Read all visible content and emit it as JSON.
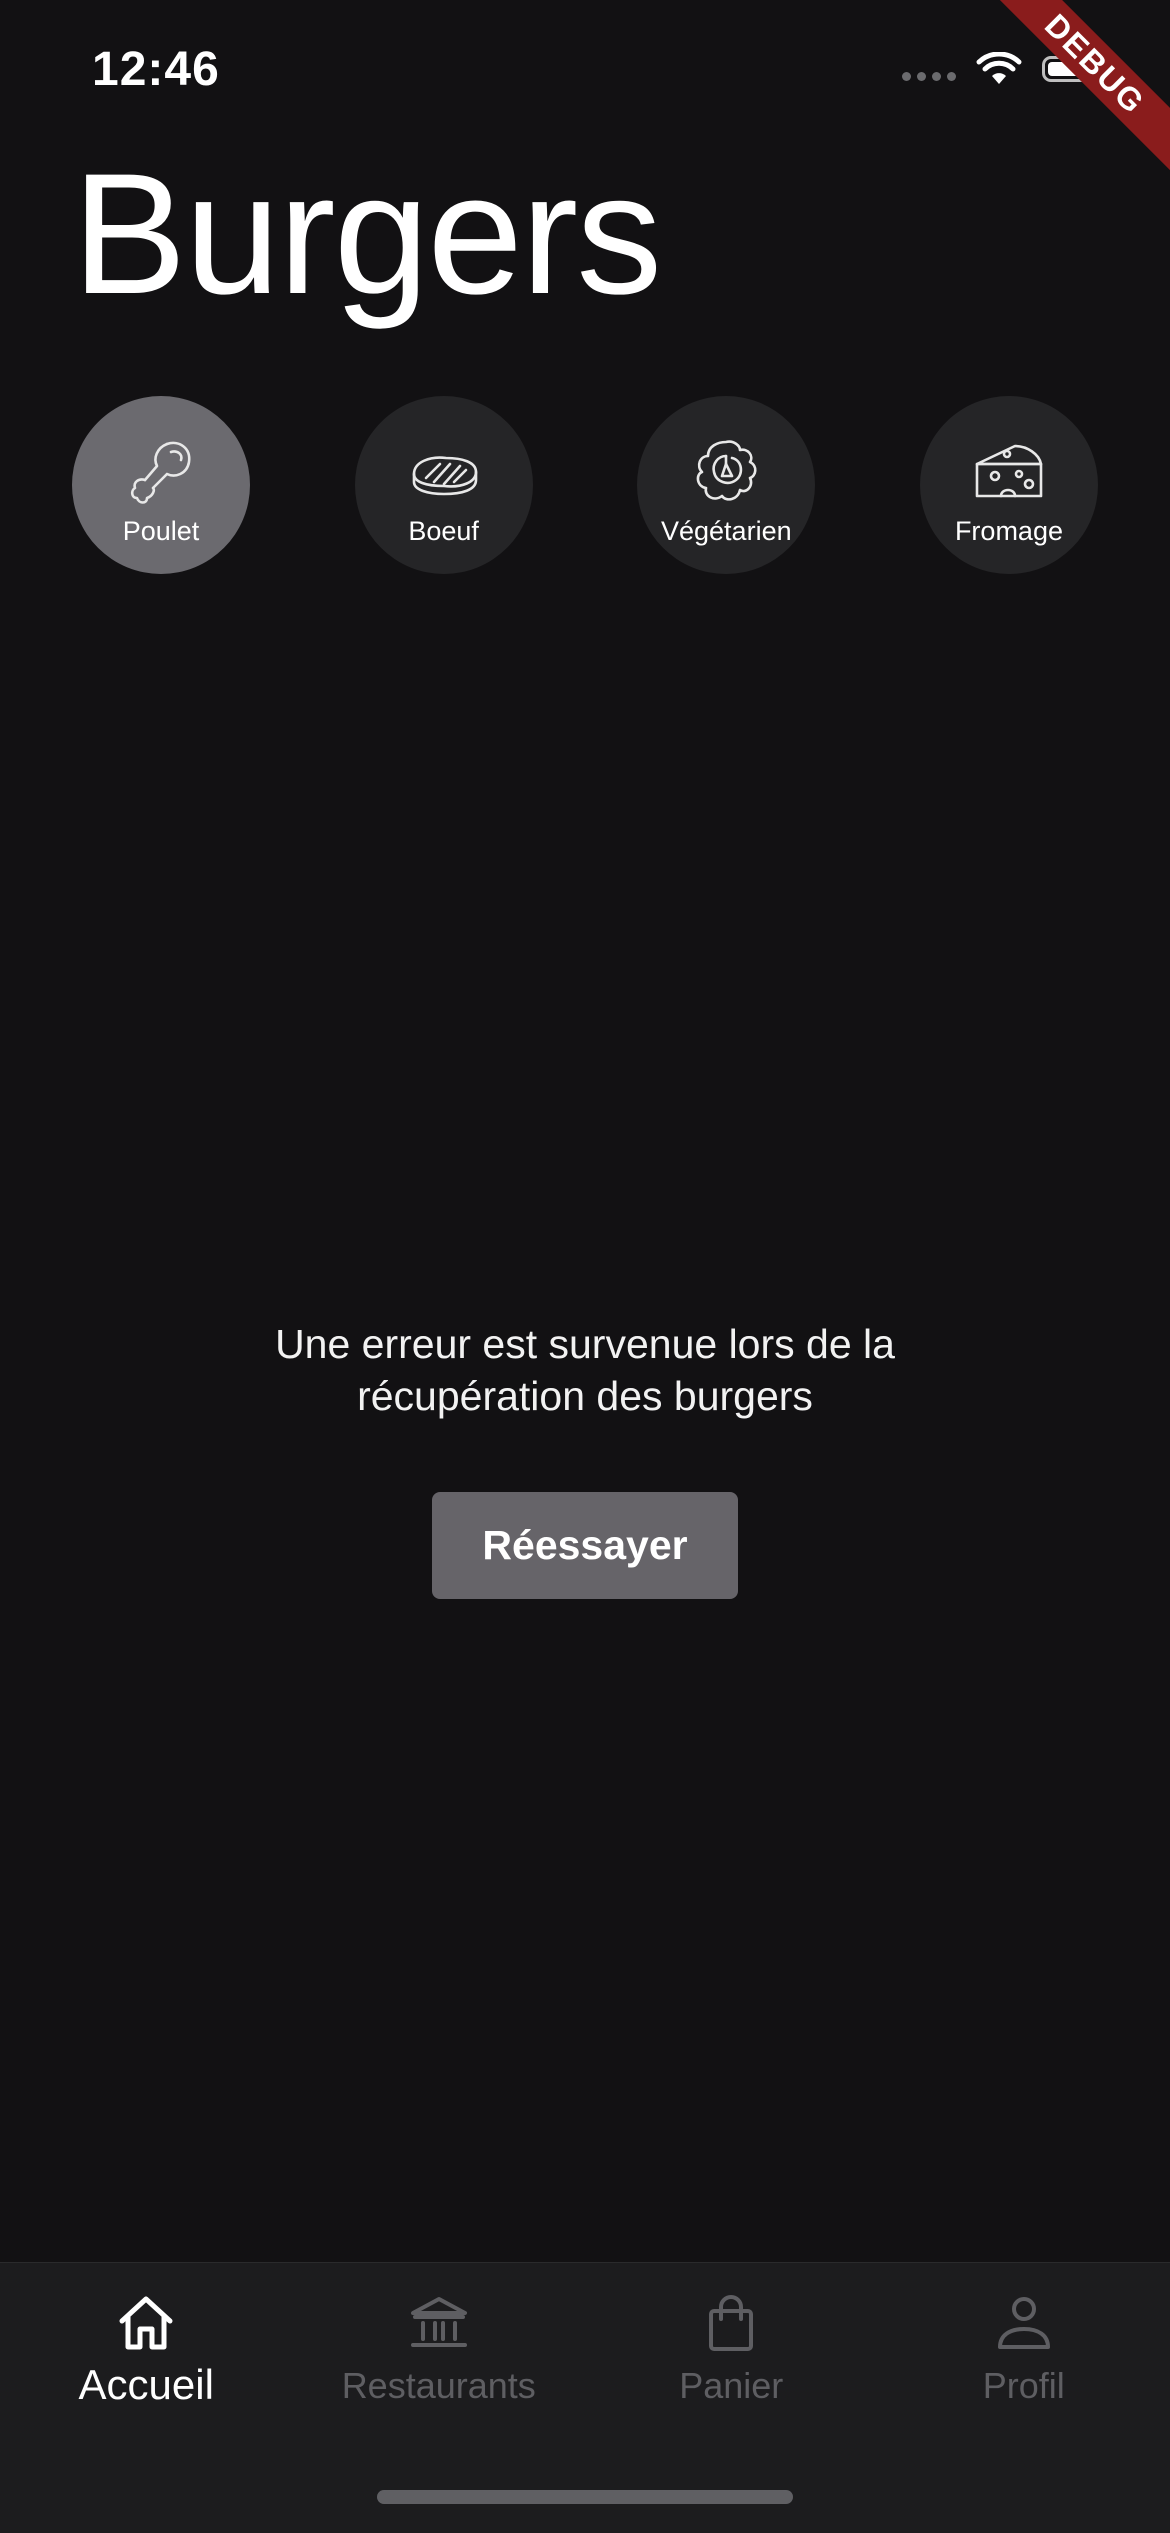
{
  "status_bar": {
    "time": "12:46"
  },
  "debug_banner": "DEBUG",
  "page": {
    "title": "Burgers"
  },
  "categories": [
    {
      "label": "Poulet",
      "icon": "chicken-leg-icon",
      "selected": true
    },
    {
      "label": "Boeuf",
      "icon": "steak-icon",
      "selected": false
    },
    {
      "label": "Végétarien",
      "icon": "cabbage-icon",
      "selected": false
    },
    {
      "label": "Fromage",
      "icon": "cheese-icon",
      "selected": false
    }
  ],
  "error": {
    "line1": "Une erreur est survenue lors de la",
    "line2": "récupération des burgers",
    "retry_label": "Réessayer"
  },
  "bottom_nav": {
    "items": [
      {
        "label": "Accueil",
        "icon": "home-icon",
        "active": true
      },
      {
        "label": "Restaurants",
        "icon": "bank-icon",
        "active": false
      },
      {
        "label": "Panier",
        "icon": "shopping-bag-icon",
        "active": false
      },
      {
        "label": "Profil",
        "icon": "person-icon",
        "active": false
      }
    ]
  },
  "colors": {
    "background": "#121113",
    "selected_category": "#6b6a6f",
    "category": "#252527",
    "button": "#666469",
    "nav_bar": "#1c1c1e",
    "nav_inactive": "#5e5e62",
    "debug_ribbon": "#8a1c1c"
  }
}
